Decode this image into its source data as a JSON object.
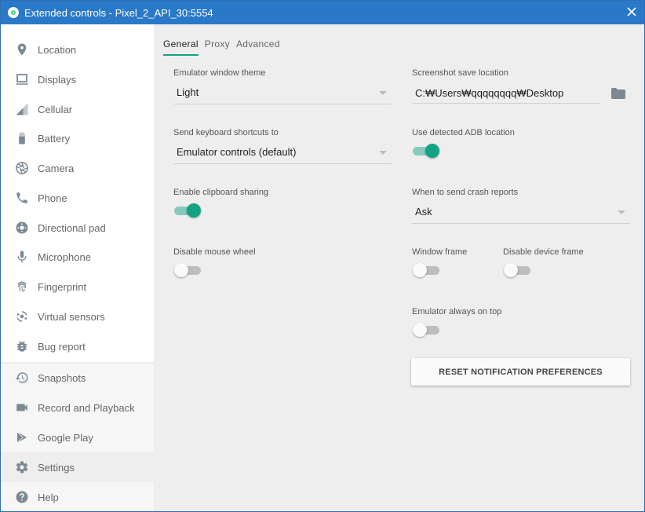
{
  "window": {
    "title": "Extended controls - Pixel_2_API_30:5554"
  },
  "sidebar": {
    "items": [
      {
        "label": "Location",
        "icon": "location-pin-icon"
      },
      {
        "label": "Displays",
        "icon": "monitor-icon"
      },
      {
        "label": "Cellular",
        "icon": "signal-icon"
      },
      {
        "label": "Battery",
        "icon": "battery-icon"
      },
      {
        "label": "Camera",
        "icon": "camera-shutter-icon"
      },
      {
        "label": "Phone",
        "icon": "phone-icon"
      },
      {
        "label": "Directional pad",
        "icon": "dpad-icon"
      },
      {
        "label": "Microphone",
        "icon": "microphone-icon"
      },
      {
        "label": "Fingerprint",
        "icon": "fingerprint-icon"
      },
      {
        "label": "Virtual sensors",
        "icon": "rotation-icon"
      },
      {
        "label": "Bug report",
        "icon": "bug-icon"
      },
      {
        "label": "Snapshots",
        "icon": "history-icon"
      },
      {
        "label": "Record and Playback",
        "icon": "videocam-icon"
      },
      {
        "label": "Google Play",
        "icon": "play-store-icon"
      },
      {
        "label": "Settings",
        "icon": "gear-icon",
        "active": true
      },
      {
        "label": "Help",
        "icon": "help-icon"
      }
    ]
  },
  "tabs": [
    {
      "label": "General",
      "active": true
    },
    {
      "label": "Proxy"
    },
    {
      "label": "Advanced"
    }
  ],
  "settings": {
    "theme": {
      "label": "Emulator window theme",
      "value": "Light"
    },
    "shortcuts": {
      "label": "Send keyboard shortcuts to",
      "value": "Emulator controls (default)"
    },
    "clipboard": {
      "label": "Enable clipboard sharing",
      "checked": true
    },
    "mouse_wheel": {
      "label": "Disable mouse wheel",
      "checked": false
    },
    "screenshot": {
      "label": "Screenshot save location",
      "value": "C:₩Users₩qqqqqqqq₩Desktop"
    },
    "adb": {
      "label": "Use detected ADB location",
      "checked": true
    },
    "crash": {
      "label": "When to send crash reports",
      "value": "Ask"
    },
    "window_frame": {
      "label": "Window frame",
      "checked": false
    },
    "device_frame": {
      "label": "Disable device frame",
      "checked": false
    },
    "always_on_top": {
      "label": "Emulator always on top",
      "checked": false
    },
    "reset_button": "RESET NOTIFICATION PREFERENCES"
  },
  "colors": {
    "accent": "#12a385",
    "titlebar": "#2a79c9",
    "icon_gray": "#7a8a94"
  }
}
